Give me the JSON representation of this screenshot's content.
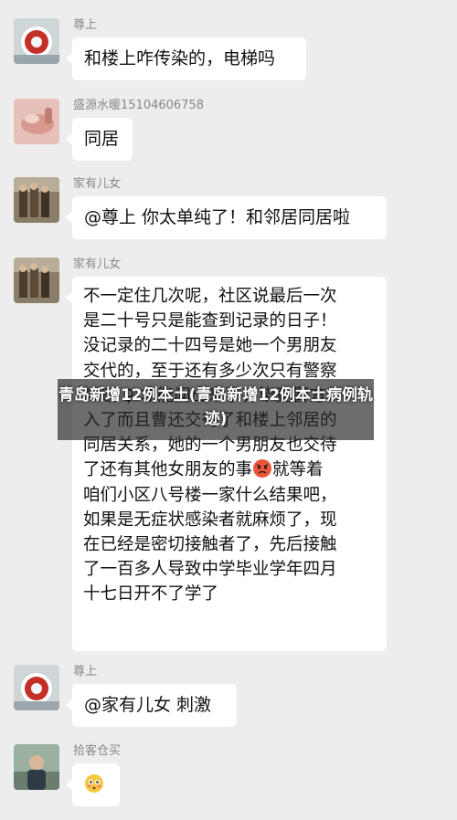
{
  "messages": [
    {
      "sender": "尊上",
      "text": "和楼上咋传染的，电梯吗",
      "avatar_icon": "red-circle-avatar-icon"
    },
    {
      "sender": "盛源水暖15104606758",
      "text": "同居",
      "avatar_icon": "hand-photo-avatar-icon"
    },
    {
      "sender": "家有儿女",
      "text": "@尊上  你太单纯了！和邻居同居啦",
      "avatar_icon": "family-photo-avatar-icon"
    },
    {
      "sender": "家有儿女",
      "text": "不一定住几次呢，社区说最后一次\n是二十号只是能查到记录的日子！\n没记录的二十四号是她一个男朋友\n交代的，至于还有多少次只有警察\n知道 ♀ 才能问出来了，毕竟警方介\n入了而且曹还交待了和楼上邻居的\n同居关系，她的一个男朋友也交待\n了还有其他女朋友的事",
      "text_after_emoji": "就等着\n咱们小区八号楼一家什么结果吧，\n如果是无症状感染者就麻烦了，现\n在已经是密切接触者了，先后接触\n了一百多人导致中学毕业学年四月\n十七日开不了学了",
      "avatar_icon": "family-photo-avatar-icon"
    },
    {
      "sender": "尊上",
      "text": "@家有儿女  刺激",
      "avatar_icon": "red-circle-avatar-icon"
    },
    {
      "sender": "拾客仓买",
      "text": "",
      "avatar_icon": "portrait-avatar-icon"
    }
  ],
  "overlay": {
    "caption": "青岛新增12例本土(青岛新增12例本土病例轨迹)"
  },
  "colors": {
    "background": "#ededed",
    "bubble": "#ffffff",
    "sender_name": "#888888"
  }
}
